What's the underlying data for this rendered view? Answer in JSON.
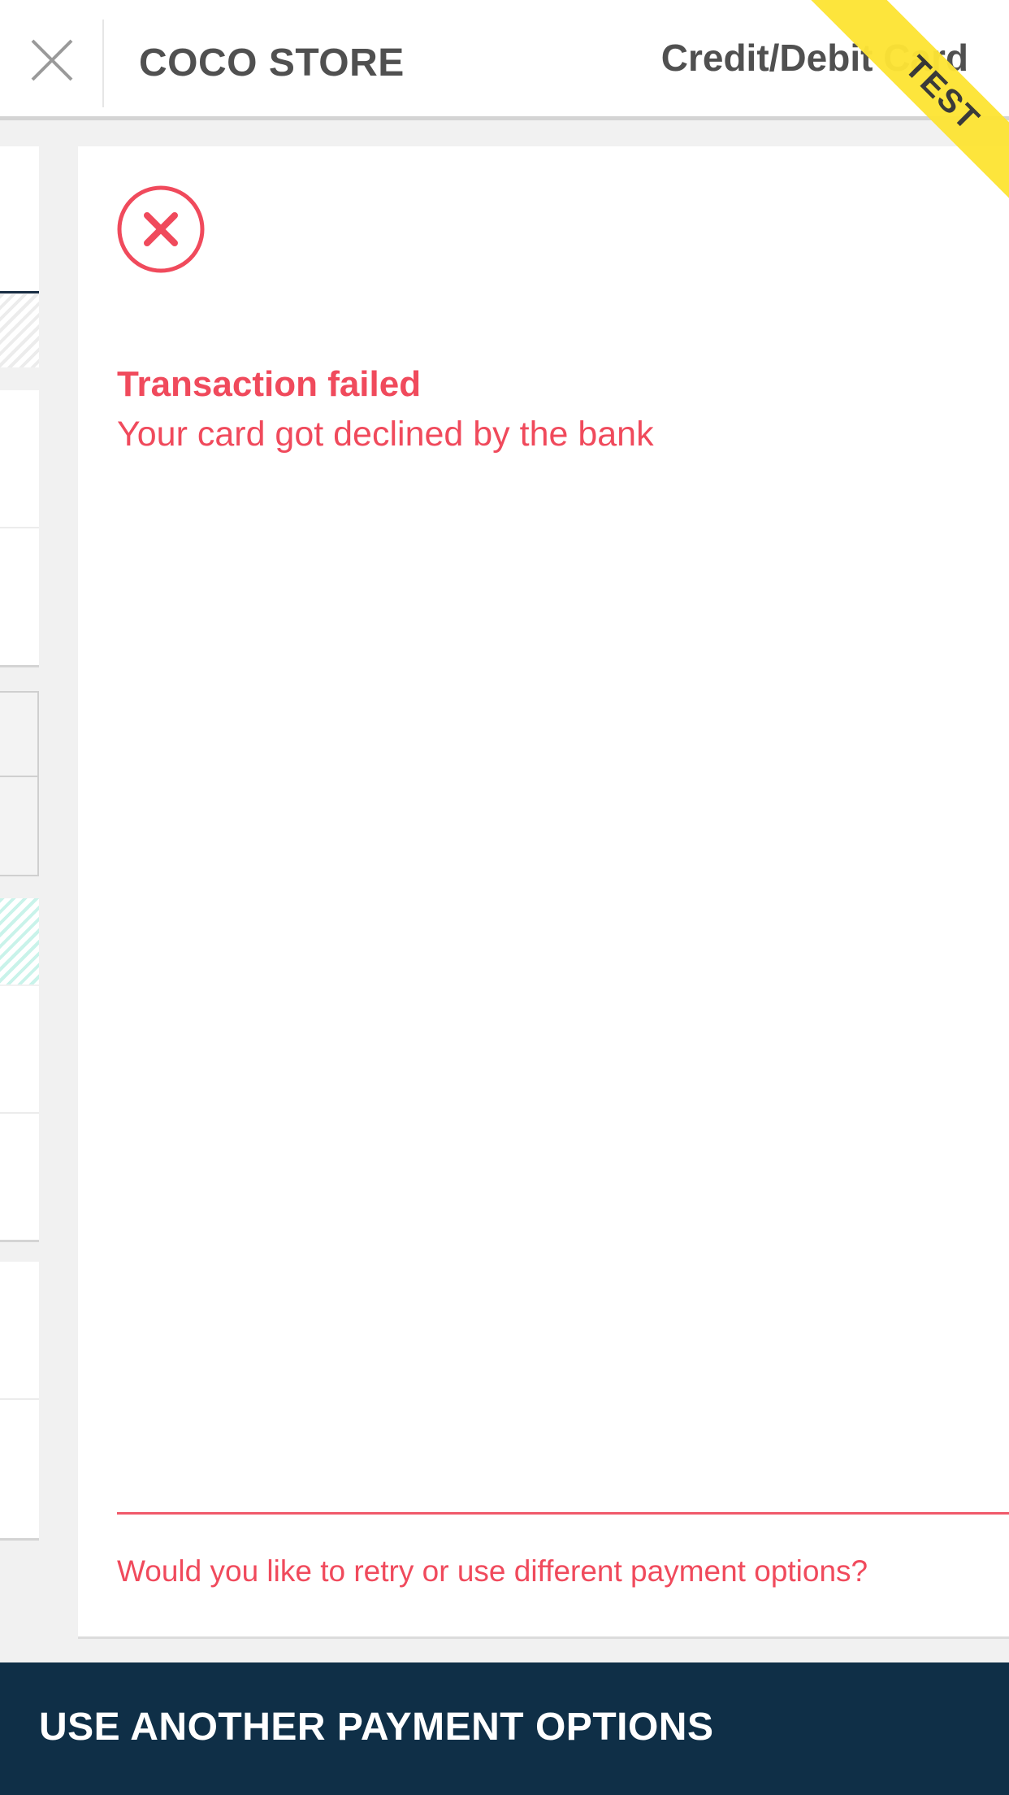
{
  "header": {
    "store_name": "COCO STORE",
    "payment_method": "Credit/Debit Card",
    "ribbon_label": "TEST",
    "close_icon": "close-icon"
  },
  "result": {
    "status_icon": "error-circle-icon",
    "title": "Transaction failed",
    "message": "Your card got declined by the bank",
    "retry_prompt": "Would you like to retry or use different payment options?"
  },
  "footer": {
    "action_label": "USE ANOTHER PAYMENT OPTIONS"
  },
  "colors": {
    "error": "#f04a5c",
    "footer_bg": "#0f2f47",
    "ribbon": "#fde435"
  }
}
